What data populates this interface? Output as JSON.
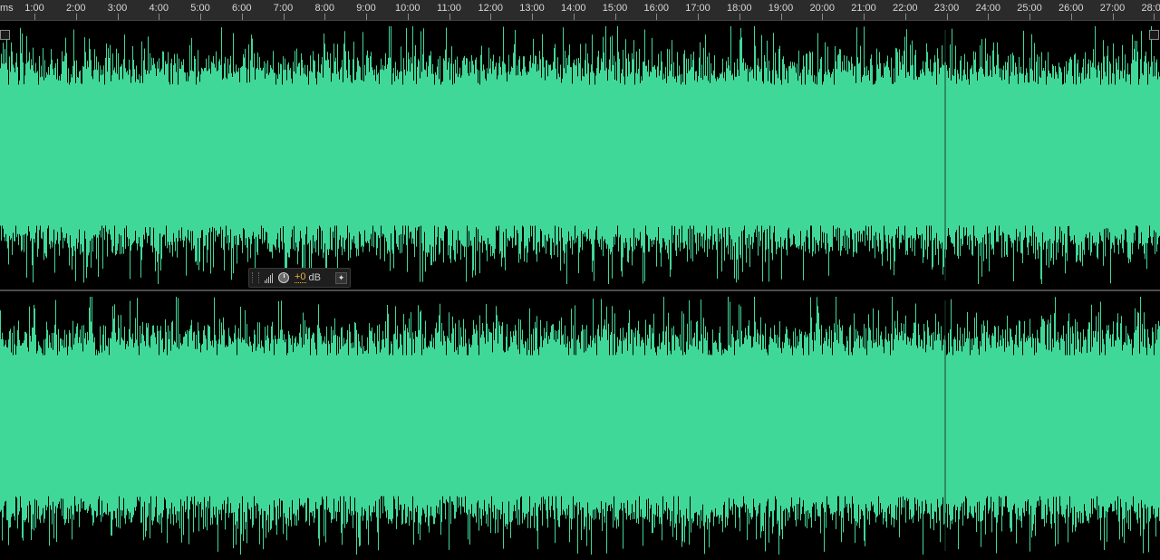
{
  "app": "Waveform Editor",
  "ruler": {
    "unit_label": "ms",
    "labels": [
      "1:00",
      "2:00",
      "3:00",
      "4:00",
      "5:00",
      "6:00",
      "7:00",
      "8:00",
      "9:00",
      "10:00",
      "11:00",
      "12:00",
      "13:00",
      "14:00",
      "15:00",
      "16:00",
      "17:00",
      "18:00",
      "19:00",
      "20:00",
      "21:00",
      "22:00",
      "23:00",
      "24:00",
      "25:00",
      "26:00",
      "27:00",
      "28:00"
    ]
  },
  "colors": {
    "waveform": "#40d898",
    "background": "#000000",
    "ruler_bg": "#2b2b2b",
    "accent_value": "#e9b43a"
  },
  "hud": {
    "icon_meter": "signal-bars-icon",
    "icon_knob": "volume-knob-icon",
    "value": "+0",
    "unit": "dB",
    "icon_pin": "pin-icon"
  },
  "channels": [
    "left-channel",
    "right-channel"
  ]
}
